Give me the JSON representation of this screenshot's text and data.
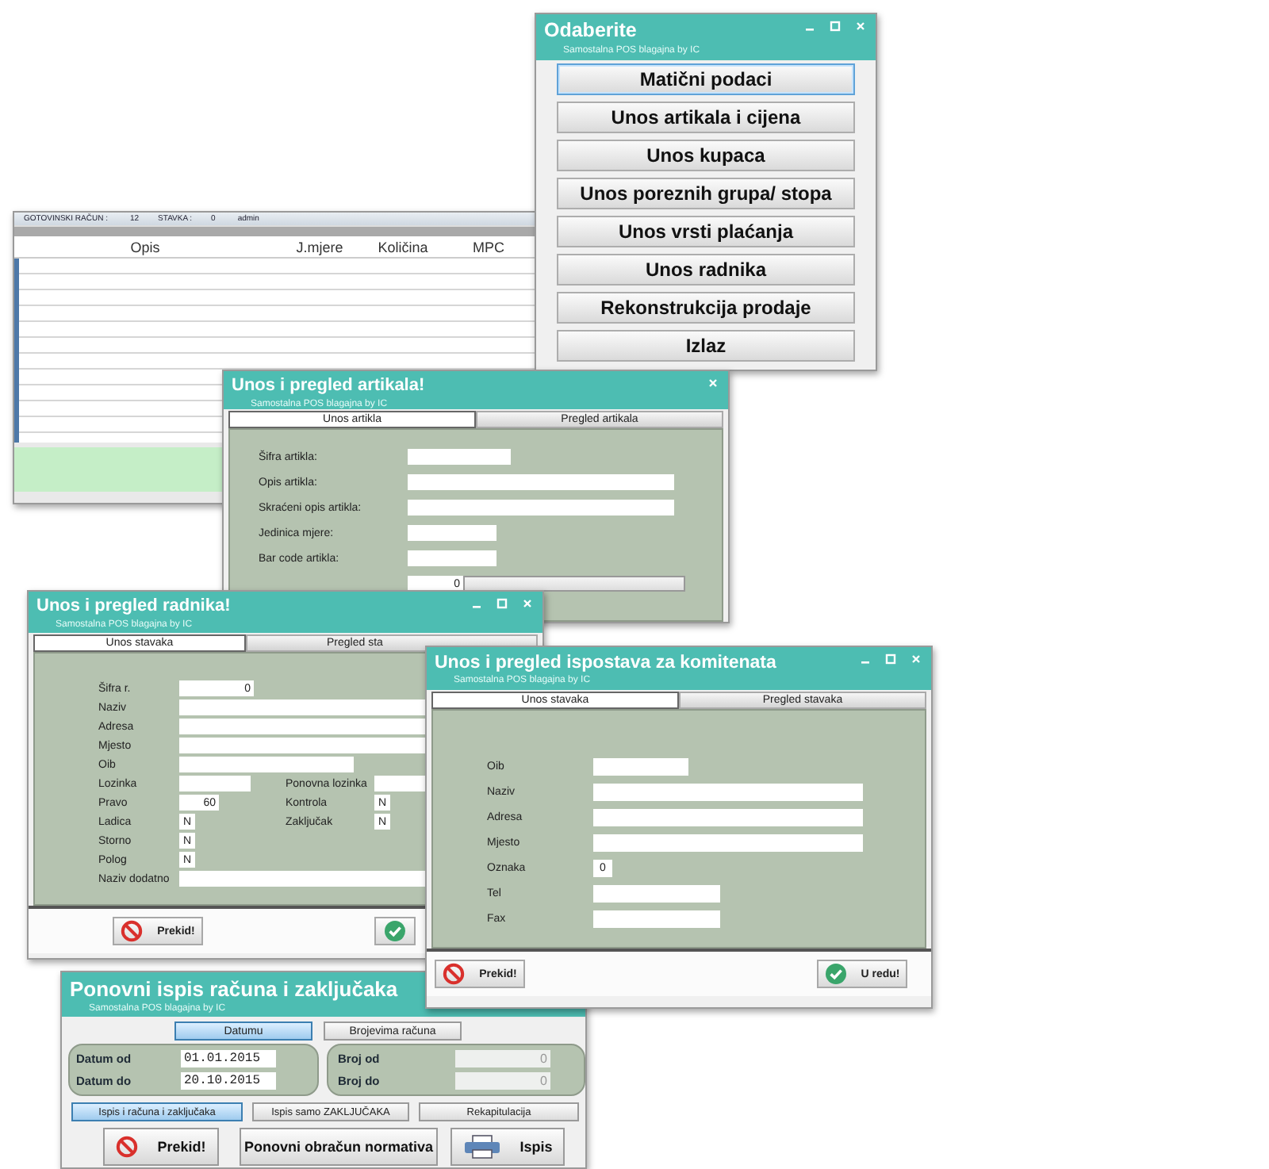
{
  "windows": [
    {
      "kind": "menu",
      "title": "Odaberite",
      "subtitle": "Samostalna POS blagajna by IC",
      "minimize_button": true,
      "maximize_button": true,
      "close_button": true,
      "buttons": [
        {
          "label": "Matični podaci",
          "selected": true
        },
        {
          "label": "Unos artikala i cijena",
          "selected": false
        },
        {
          "label": "Unos kupaca",
          "selected": false
        },
        {
          "label": "Unos poreznih grupa/ stopa",
          "selected": false
        },
        {
          "label": "Unos vrsti plaćanja",
          "selected": false
        },
        {
          "label": "Unos radnika",
          "selected": false
        },
        {
          "label": "Rekonstrukcija prodaje",
          "selected": false
        },
        {
          "label": "Izlaz",
          "selected": false
        }
      ]
    },
    {
      "kind": "sale",
      "status": [
        "GOTOVINSKI RAČUN :",
        "12",
        "STAVKA :",
        "0",
        "admin"
      ],
      "columns": [
        "Opis",
        "J.mjere",
        "Količina",
        "MPC"
      ]
    },
    {
      "kind": "form",
      "title": "Unos i pregled artikala!",
      "subtitle": "Samostalna POS blagajna by IC",
      "minimize_button": false,
      "maximize_button": false,
      "close_button": true,
      "tabs": [
        {
          "label": "Unos artikla",
          "selected": true
        },
        {
          "label": "Pregled artikala",
          "selected": false
        }
      ],
      "rows": [
        {
          "fields": [
            {
              "kind": "text",
              "label": "Šifra artikla:"
            }
          ]
        },
        {
          "fields": [
            {
              "kind": "text",
              "label": "Opis artikla:"
            }
          ]
        },
        {
          "fields": [
            {
              "kind": "text",
              "label": "Skraćeni opis artikla:"
            }
          ]
        },
        {
          "fields": [
            {
              "kind": "text",
              "label": "Jedinica mjere:"
            }
          ]
        },
        {
          "fields": [
            {
              "kind": "text",
              "label": "Bar code artikla:"
            }
          ]
        },
        {
          "fields": [
            {
              "kind": "lookup",
              "value": "0"
            }
          ]
        }
      ]
    },
    {
      "kind": "form",
      "title": "Unos i pregled radnika!",
      "subtitle": "Samostalna POS blagajna by IC",
      "minimize_button": true,
      "maximize_button": true,
      "close_button": true,
      "tabs": [
        {
          "label": "Unos stavaka",
          "selected": true
        },
        {
          "label": "Pregled sta",
          "selected": false
        }
      ],
      "rows": [
        {
          "fields": [
            {
              "label": "Šifra r.",
              "value": "0"
            }
          ]
        },
        {
          "fields": [
            {
              "label": "Naziv"
            }
          ]
        },
        {
          "fields": [
            {
              "label": "Adresa"
            }
          ]
        },
        {
          "fields": [
            {
              "label": "Mjesto"
            }
          ]
        },
        {
          "fields": [
            {
              "label": "Oib"
            }
          ]
        },
        {
          "fields": [
            {
              "label": "Lozinka"
            },
            {
              "label": "Ponovna lozinka"
            }
          ]
        },
        {
          "fields": [
            {
              "label": "Pravo",
              "value": "60"
            },
            {
              "label": "Kontrola",
              "value": "N"
            }
          ]
        },
        {
          "fields": [
            {
              "label": "Ladica",
              "value": "N"
            },
            {
              "label": "Zaključak",
              "value": "N"
            }
          ]
        },
        {
          "fields": [
            {
              "label": "Storno",
              "value": "N"
            }
          ]
        },
        {
          "fields": [
            {
              "label": "Polog",
              "value": "N"
            }
          ]
        },
        {
          "fields": [
            {
              "label": "Naziv dodatno"
            }
          ]
        }
      ],
      "buttons": [
        {
          "kind": "cancel",
          "label": "Prekid!"
        },
        {
          "kind": "confirm"
        }
      ]
    },
    {
      "kind": "form",
      "title": "Unos i pregled ispostava za komitenata",
      "subtitle": "Samostalna POS blagajna by IC",
      "minimize_button": true,
      "maximize_button": true,
      "close_button": true,
      "tabs": [
        {
          "label": "Unos stavaka",
          "selected": true
        },
        {
          "label": "Pregled stavaka",
          "selected": false
        }
      ],
      "rows": [
        {
          "fields": [
            {
              "label": "Oib"
            }
          ]
        },
        {
          "fields": [
            {
              "label": "Naziv"
            }
          ]
        },
        {
          "fields": [
            {
              "label": "Adresa"
            }
          ]
        },
        {
          "fields": [
            {
              "label": "Mjesto"
            }
          ]
        },
        {
          "fields": [
            {
              "label": "Oznaka",
              "value": "0"
            }
          ]
        },
        {
          "fields": [
            {
              "label": "Tel"
            }
          ]
        },
        {
          "fields": [
            {
              "label": "Fax"
            }
          ]
        }
      ],
      "buttons": [
        {
          "kind": "cancel",
          "label": "Prekid!"
        },
        {
          "kind": "confirm",
          "label": "U redu!"
        }
      ]
    },
    {
      "kind": "reprint",
      "title": "Ponovni ispis računa i zaključaka",
      "subtitle": "Samostalna POS blagajna by IC",
      "minimize_button": false,
      "maximize_button": false,
      "close_button": false,
      "mode_buttons": [
        {
          "label": "Datumu",
          "selected": true
        },
        {
          "label": "Brojevima računa",
          "selected": false
        }
      ],
      "date_range": [
        {
          "label": "Datum od",
          "value": "01.01.2015",
          "disabled": false
        },
        {
          "label": "Datum do",
          "value": "20.10.2015",
          "disabled": false
        }
      ],
      "number_range": [
        {
          "label": "Broj od",
          "value": "0",
          "disabled": true
        },
        {
          "label": "Broj do",
          "value": "0",
          "disabled": true
        }
      ],
      "print_options": [
        {
          "label": "Ispis i računa i zaključaka",
          "selected": true
        },
        {
          "label": "Ispis samo ZAKLJUČAKA",
          "selected": false
        },
        {
          "label": "Rekapitulacija",
          "selected": false
        }
      ],
      "buttons": [
        {
          "kind": "cancel",
          "label": "Prekid!"
        },
        {
          "kind": "plain",
          "label": "Ponovni obračun normativa"
        },
        {
          "kind": "print",
          "label": "Ispis"
        }
      ]
    }
  ]
}
